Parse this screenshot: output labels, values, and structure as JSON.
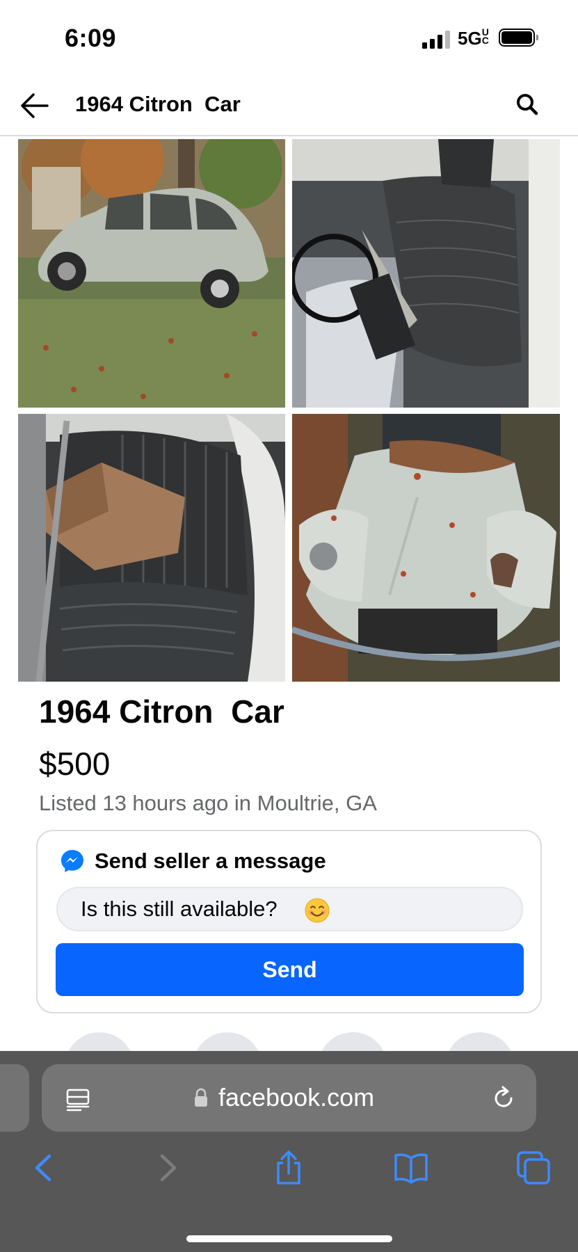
{
  "status_bar": {
    "time": "6:09",
    "network": "5GUC",
    "network_main": "5G",
    "network_sup": "U",
    "network_sub": "C"
  },
  "nav": {
    "back_icon": "arrow-left-icon",
    "title": "1964 Citron  Car",
    "search_icon": "search-icon"
  },
  "photos": [
    {
      "description": "photo-1"
    },
    {
      "description": "photo-2"
    },
    {
      "description": "photo-3"
    },
    {
      "description": "photo-4"
    }
  ],
  "listing": {
    "title": "1964 Citron  Car",
    "price": "$500",
    "listed": "Listed 13 hours ago in Moultrie, GA"
  },
  "message_card": {
    "title": "Send seller a message",
    "input_value": "Is this still available?",
    "emoji": "smiling-face-emoji",
    "send_label": "Send"
  },
  "browser": {
    "url": "facebook.com",
    "toolbar": [
      "back-icon",
      "forward-icon",
      "share-icon",
      "bookmarks-icon",
      "tabs-icon"
    ]
  },
  "colors": {
    "accent": "#0866ff",
    "safari_bar": "#575757",
    "toolbar_icon": "#3c8cff"
  }
}
